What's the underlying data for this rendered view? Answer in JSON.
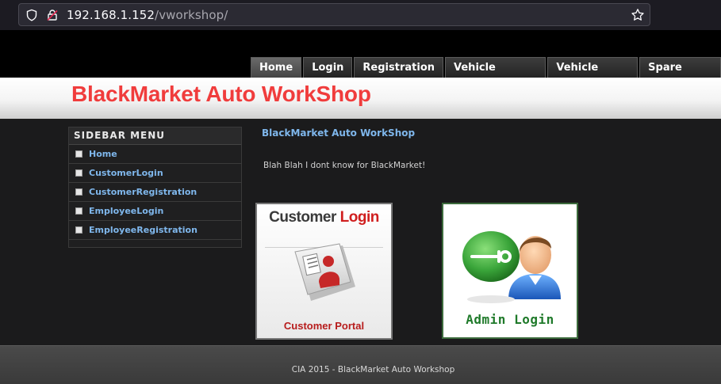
{
  "browser": {
    "url_host": "192.168.1.152",
    "url_path": "/vworkshop/"
  },
  "nav": {
    "tabs": [
      "Home",
      "Login",
      "Registration",
      "Vehicle Service",
      "Vehicle Store",
      "Spare Parts"
    ],
    "active": "Home"
  },
  "header": {
    "site_title": "BlackMarket Auto WorkShop"
  },
  "sidebar": {
    "title": "SIDEBAR MENU",
    "items": [
      "Home",
      "CustomerLogin",
      "CustomerRegistration",
      "EmployeeLogin",
      "EmployeeRegistration"
    ]
  },
  "content": {
    "title": "BlackMarket Auto WorkShop",
    "text": "Blah Blah I dont know for BlackMarket!",
    "customer_card": {
      "title_part1": "Customer ",
      "title_part2": "Login",
      "subtitle": "Customer Portal"
    },
    "admin_card": {
      "label": "Admin Login"
    }
  },
  "footer": {
    "text": "CIA 2015 - BlackMarket Auto Workshop"
  },
  "colors": {
    "title_red": "#f03c3c",
    "link_blue": "#7fb7ec",
    "admin_green": "#1f7a2a"
  }
}
